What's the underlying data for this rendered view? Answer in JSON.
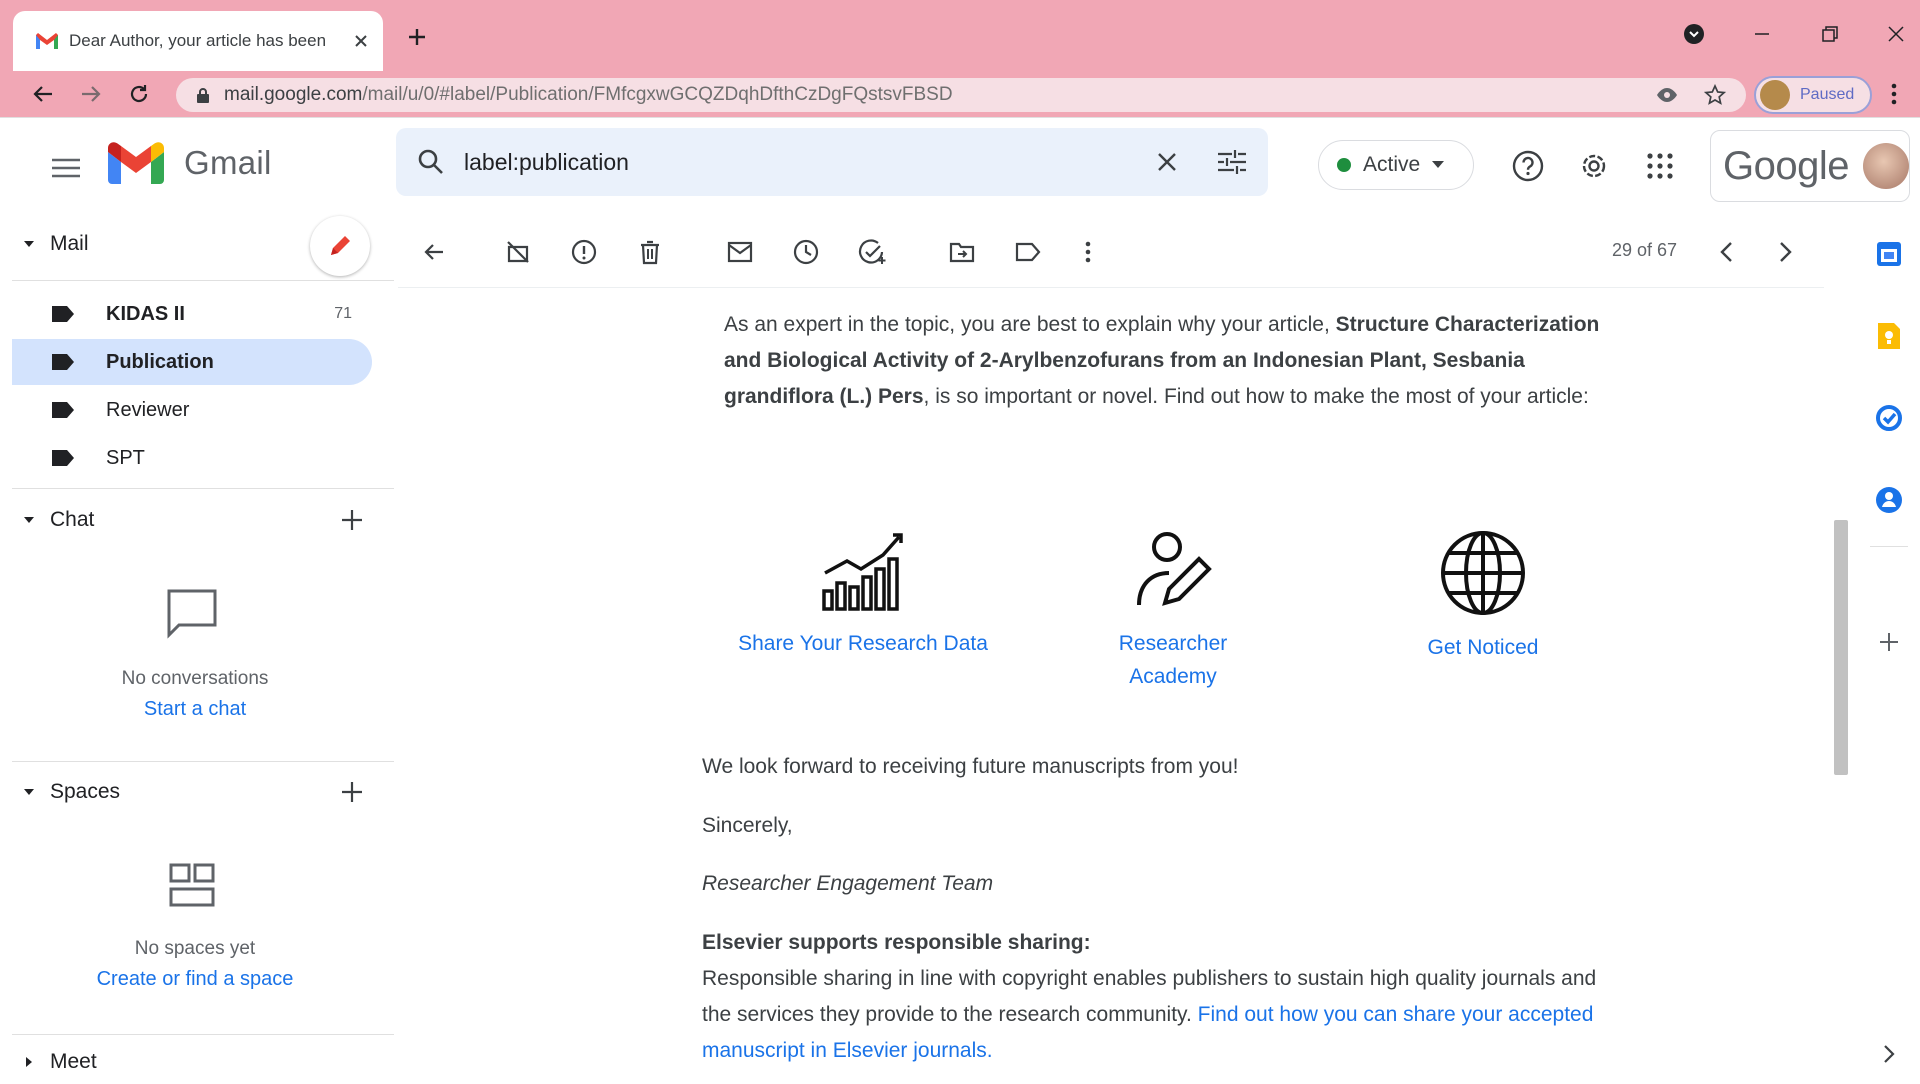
{
  "browser": {
    "tab_title": "Dear Author, your article has been",
    "url_host": "mail.google.com",
    "url_path": "/mail/u/0/#label/Publication/FMfcgxwGCQZDqhDfthCzDgFQstsvFBSD",
    "profile_status": "Paused"
  },
  "gmail": {
    "logo_text": "Gmail",
    "search_value": "label:publication",
    "status": "Active",
    "google_word": "Google"
  },
  "sidebar": {
    "mail_heading": "Mail",
    "labels": [
      {
        "name": "KIDAS II",
        "count": "71"
      },
      {
        "name": "Publication",
        "count": ""
      },
      {
        "name": "Reviewer",
        "count": ""
      },
      {
        "name": "SPT",
        "count": ""
      }
    ],
    "chat_heading": "Chat",
    "chat_empty": "No conversations",
    "chat_link": "Start a chat",
    "spaces_heading": "Spaces",
    "spaces_empty": "No spaces yet",
    "spaces_link": "Create or find a space",
    "meet_heading": "Meet"
  },
  "toolbar": {
    "pager": "29 of 67"
  },
  "email": {
    "intro_plain_1": "As an expert in the topic, you are best to explain why your article, ",
    "intro_bold": "Structure Characterization and Biological Activity of 2-Arylbenzofurans from an Indonesian Plant, Sesbania grandiflora (L.) Pers",
    "intro_plain_2": ", is so important or novel. Find out how to make the most of your article:",
    "features": [
      {
        "icon": "bar-chart-growth-icon",
        "label": "Share Your Research Data"
      },
      {
        "icon": "researcher-pencil-icon",
        "label": "Researcher Academy"
      },
      {
        "icon": "globe-icon",
        "label": "Get Noticed"
      }
    ],
    "look_forward": "We look forward to receiving future manuscripts from you!",
    "sincerely": "Sincerely,",
    "team": "Researcher Engagement Team",
    "sharing_heading": "Elsevier supports responsible sharing:",
    "sharing_text": "Responsible sharing in line with copyright enables publishers to sustain high quality journals and the services they provide to the research community. ",
    "sharing_link": "Find out how you can share your accepted manuscript in Elsevier journals."
  },
  "colors": {
    "browser_frame": "#f1a7b5",
    "link": "#1a73e8",
    "selected_label": "#d3e3fd",
    "active_dot": "#1e8e3e"
  }
}
